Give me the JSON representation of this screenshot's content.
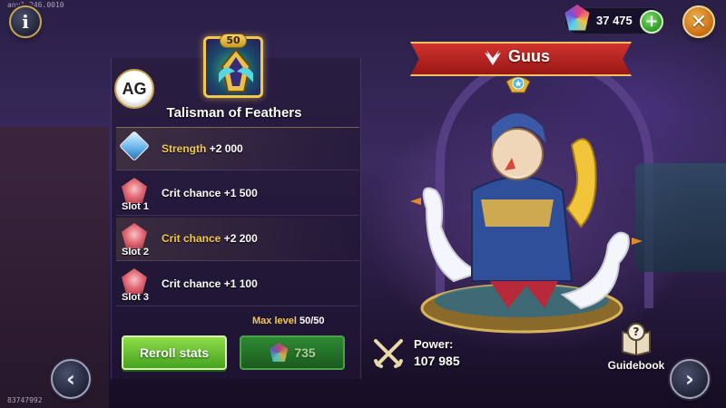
{
  "debug": {
    "build": "any1.246.0010",
    "id": "83747992"
  },
  "currency": {
    "emeralds": "37 475"
  },
  "icons": {
    "info": "info-icon",
    "close": "close-icon",
    "add": "plus-icon",
    "prev": "chevron-left-icon",
    "next": "chevron-right-icon",
    "power": "crossed-swords-icon",
    "guidebook": "book-question-icon"
  },
  "logo": {
    "text": "AG"
  },
  "artifact": {
    "level": "50",
    "name": "Talisman of Feathers",
    "stats": [
      {
        "name": "Strength",
        "value": "+2 000",
        "slot": "",
        "highlight": true,
        "icon": "strength-diamond-icon"
      },
      {
        "name": "Crit chance",
        "value": "+1 500",
        "slot": "Slot 1",
        "highlight": false,
        "icon": "crit-gem-icon"
      },
      {
        "name": "Crit chance",
        "value": "+2 200",
        "slot": "Slot 2",
        "highlight": true,
        "icon": "crit-gem-icon"
      },
      {
        "name": "Crit chance",
        "value": "+1 100",
        "slot": "Slot 3",
        "highlight": false,
        "icon": "crit-gem-icon"
      }
    ],
    "max_level_label": "Max level",
    "max_level_value": "50/50"
  },
  "buttons": {
    "reroll": "Reroll stats",
    "cost": "735"
  },
  "hero": {
    "name": "Guus",
    "power_label": "Power:",
    "power_value": "107 985"
  },
  "guidebook": {
    "label": "Guidebook"
  },
  "colors": {
    "gold": "#f3c94e",
    "banner_red": "#c42a27",
    "button_green": "#6cc33a"
  }
}
